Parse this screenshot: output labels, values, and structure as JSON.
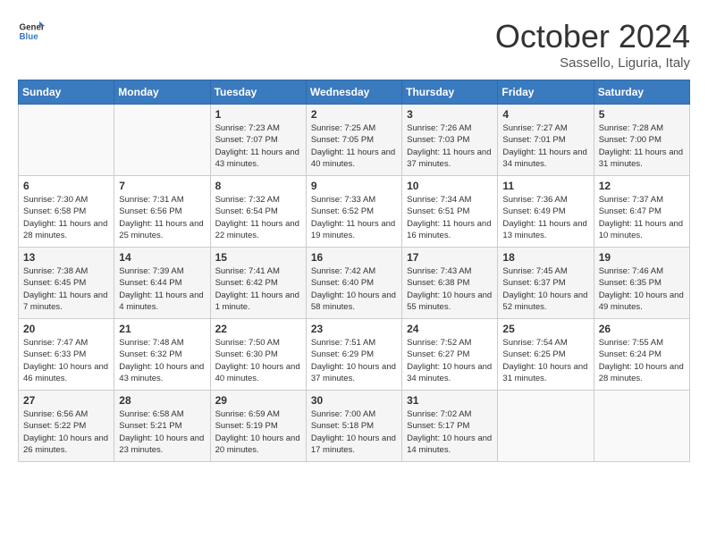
{
  "header": {
    "logo_line1": "General",
    "logo_line2": "Blue",
    "month": "October 2024",
    "location": "Sassello, Liguria, Italy"
  },
  "days_of_week": [
    "Sunday",
    "Monday",
    "Tuesday",
    "Wednesday",
    "Thursday",
    "Friday",
    "Saturday"
  ],
  "weeks": [
    [
      {
        "day": "",
        "info": ""
      },
      {
        "day": "",
        "info": ""
      },
      {
        "day": "1",
        "info": "Sunrise: 7:23 AM\nSunset: 7:07 PM\nDaylight: 11 hours and 43 minutes."
      },
      {
        "day": "2",
        "info": "Sunrise: 7:25 AM\nSunset: 7:05 PM\nDaylight: 11 hours and 40 minutes."
      },
      {
        "day": "3",
        "info": "Sunrise: 7:26 AM\nSunset: 7:03 PM\nDaylight: 11 hours and 37 minutes."
      },
      {
        "day": "4",
        "info": "Sunrise: 7:27 AM\nSunset: 7:01 PM\nDaylight: 11 hours and 34 minutes."
      },
      {
        "day": "5",
        "info": "Sunrise: 7:28 AM\nSunset: 7:00 PM\nDaylight: 11 hours and 31 minutes."
      }
    ],
    [
      {
        "day": "6",
        "info": "Sunrise: 7:30 AM\nSunset: 6:58 PM\nDaylight: 11 hours and 28 minutes."
      },
      {
        "day": "7",
        "info": "Sunrise: 7:31 AM\nSunset: 6:56 PM\nDaylight: 11 hours and 25 minutes."
      },
      {
        "day": "8",
        "info": "Sunrise: 7:32 AM\nSunset: 6:54 PM\nDaylight: 11 hours and 22 minutes."
      },
      {
        "day": "9",
        "info": "Sunrise: 7:33 AM\nSunset: 6:52 PM\nDaylight: 11 hours and 19 minutes."
      },
      {
        "day": "10",
        "info": "Sunrise: 7:34 AM\nSunset: 6:51 PM\nDaylight: 11 hours and 16 minutes."
      },
      {
        "day": "11",
        "info": "Sunrise: 7:36 AM\nSunset: 6:49 PM\nDaylight: 11 hours and 13 minutes."
      },
      {
        "day": "12",
        "info": "Sunrise: 7:37 AM\nSunset: 6:47 PM\nDaylight: 11 hours and 10 minutes."
      }
    ],
    [
      {
        "day": "13",
        "info": "Sunrise: 7:38 AM\nSunset: 6:45 PM\nDaylight: 11 hours and 7 minutes."
      },
      {
        "day": "14",
        "info": "Sunrise: 7:39 AM\nSunset: 6:44 PM\nDaylight: 11 hours and 4 minutes."
      },
      {
        "day": "15",
        "info": "Sunrise: 7:41 AM\nSunset: 6:42 PM\nDaylight: 11 hours and 1 minute."
      },
      {
        "day": "16",
        "info": "Sunrise: 7:42 AM\nSunset: 6:40 PM\nDaylight: 10 hours and 58 minutes."
      },
      {
        "day": "17",
        "info": "Sunrise: 7:43 AM\nSunset: 6:38 PM\nDaylight: 10 hours and 55 minutes."
      },
      {
        "day": "18",
        "info": "Sunrise: 7:45 AM\nSunset: 6:37 PM\nDaylight: 10 hours and 52 minutes."
      },
      {
        "day": "19",
        "info": "Sunrise: 7:46 AM\nSunset: 6:35 PM\nDaylight: 10 hours and 49 minutes."
      }
    ],
    [
      {
        "day": "20",
        "info": "Sunrise: 7:47 AM\nSunset: 6:33 PM\nDaylight: 10 hours and 46 minutes."
      },
      {
        "day": "21",
        "info": "Sunrise: 7:48 AM\nSunset: 6:32 PM\nDaylight: 10 hours and 43 minutes."
      },
      {
        "day": "22",
        "info": "Sunrise: 7:50 AM\nSunset: 6:30 PM\nDaylight: 10 hours and 40 minutes."
      },
      {
        "day": "23",
        "info": "Sunrise: 7:51 AM\nSunset: 6:29 PM\nDaylight: 10 hours and 37 minutes."
      },
      {
        "day": "24",
        "info": "Sunrise: 7:52 AM\nSunset: 6:27 PM\nDaylight: 10 hours and 34 minutes."
      },
      {
        "day": "25",
        "info": "Sunrise: 7:54 AM\nSunset: 6:25 PM\nDaylight: 10 hours and 31 minutes."
      },
      {
        "day": "26",
        "info": "Sunrise: 7:55 AM\nSunset: 6:24 PM\nDaylight: 10 hours and 28 minutes."
      }
    ],
    [
      {
        "day": "27",
        "info": "Sunrise: 6:56 AM\nSunset: 5:22 PM\nDaylight: 10 hours and 26 minutes."
      },
      {
        "day": "28",
        "info": "Sunrise: 6:58 AM\nSunset: 5:21 PM\nDaylight: 10 hours and 23 minutes."
      },
      {
        "day": "29",
        "info": "Sunrise: 6:59 AM\nSunset: 5:19 PM\nDaylight: 10 hours and 20 minutes."
      },
      {
        "day": "30",
        "info": "Sunrise: 7:00 AM\nSunset: 5:18 PM\nDaylight: 10 hours and 17 minutes."
      },
      {
        "day": "31",
        "info": "Sunrise: 7:02 AM\nSunset: 5:17 PM\nDaylight: 10 hours and 14 minutes."
      },
      {
        "day": "",
        "info": ""
      },
      {
        "day": "",
        "info": ""
      }
    ]
  ]
}
